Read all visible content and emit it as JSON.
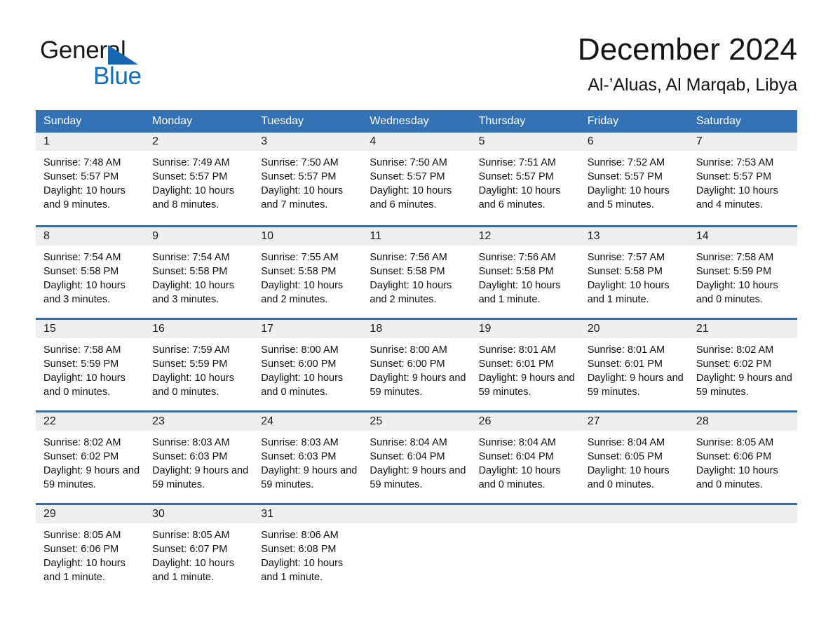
{
  "brand": {
    "name_part1": "General",
    "name_part2": "Blue",
    "triangle_color": "#1567b2",
    "blue_color": "#0d6ebe"
  },
  "header": {
    "title": "December 2024",
    "subtitle": "Al-’Aluas, Al Marqab, Libya"
  },
  "colors": {
    "header_blue": "#3272b5",
    "row_divider_blue": "#2e6da8",
    "day_band_gray": "#efefef"
  },
  "weekdays": [
    "Sunday",
    "Monday",
    "Tuesday",
    "Wednesday",
    "Thursday",
    "Friday",
    "Saturday"
  ],
  "weeks": [
    [
      {
        "day": "1",
        "sunrise": "Sunrise: 7:48 AM",
        "sunset": "Sunset: 5:57 PM",
        "daylight": "Daylight: 10 hours and 9 minutes."
      },
      {
        "day": "2",
        "sunrise": "Sunrise: 7:49 AM",
        "sunset": "Sunset: 5:57 PM",
        "daylight": "Daylight: 10 hours and 8 minutes."
      },
      {
        "day": "3",
        "sunrise": "Sunrise: 7:50 AM",
        "sunset": "Sunset: 5:57 PM",
        "daylight": "Daylight: 10 hours and 7 minutes."
      },
      {
        "day": "4",
        "sunrise": "Sunrise: 7:50 AM",
        "sunset": "Sunset: 5:57 PM",
        "daylight": "Daylight: 10 hours and 6 minutes."
      },
      {
        "day": "5",
        "sunrise": "Sunrise: 7:51 AM",
        "sunset": "Sunset: 5:57 PM",
        "daylight": "Daylight: 10 hours and 6 minutes."
      },
      {
        "day": "6",
        "sunrise": "Sunrise: 7:52 AM",
        "sunset": "Sunset: 5:57 PM",
        "daylight": "Daylight: 10 hours and 5 minutes."
      },
      {
        "day": "7",
        "sunrise": "Sunrise: 7:53 AM",
        "sunset": "Sunset: 5:57 PM",
        "daylight": "Daylight: 10 hours and 4 minutes."
      }
    ],
    [
      {
        "day": "8",
        "sunrise": "Sunrise: 7:54 AM",
        "sunset": "Sunset: 5:58 PM",
        "daylight": "Daylight: 10 hours and 3 minutes."
      },
      {
        "day": "9",
        "sunrise": "Sunrise: 7:54 AM",
        "sunset": "Sunset: 5:58 PM",
        "daylight": "Daylight: 10 hours and 3 minutes."
      },
      {
        "day": "10",
        "sunrise": "Sunrise: 7:55 AM",
        "sunset": "Sunset: 5:58 PM",
        "daylight": "Daylight: 10 hours and 2 minutes."
      },
      {
        "day": "11",
        "sunrise": "Sunrise: 7:56 AM",
        "sunset": "Sunset: 5:58 PM",
        "daylight": "Daylight: 10 hours and 2 minutes."
      },
      {
        "day": "12",
        "sunrise": "Sunrise: 7:56 AM",
        "sunset": "Sunset: 5:58 PM",
        "daylight": "Daylight: 10 hours and 1 minute."
      },
      {
        "day": "13",
        "sunrise": "Sunrise: 7:57 AM",
        "sunset": "Sunset: 5:58 PM",
        "daylight": "Daylight: 10 hours and 1 minute."
      },
      {
        "day": "14",
        "sunrise": "Sunrise: 7:58 AM",
        "sunset": "Sunset: 5:59 PM",
        "daylight": "Daylight: 10 hours and 0 minutes."
      }
    ],
    [
      {
        "day": "15",
        "sunrise": "Sunrise: 7:58 AM",
        "sunset": "Sunset: 5:59 PM",
        "daylight": "Daylight: 10 hours and 0 minutes."
      },
      {
        "day": "16",
        "sunrise": "Sunrise: 7:59 AM",
        "sunset": "Sunset: 5:59 PM",
        "daylight": "Daylight: 10 hours and 0 minutes."
      },
      {
        "day": "17",
        "sunrise": "Sunrise: 8:00 AM",
        "sunset": "Sunset: 6:00 PM",
        "daylight": "Daylight: 10 hours and 0 minutes."
      },
      {
        "day": "18",
        "sunrise": "Sunrise: 8:00 AM",
        "sunset": "Sunset: 6:00 PM",
        "daylight": "Daylight: 9 hours and 59 minutes."
      },
      {
        "day": "19",
        "sunrise": "Sunrise: 8:01 AM",
        "sunset": "Sunset: 6:01 PM",
        "daylight": "Daylight: 9 hours and 59 minutes."
      },
      {
        "day": "20",
        "sunrise": "Sunrise: 8:01 AM",
        "sunset": "Sunset: 6:01 PM",
        "daylight": "Daylight: 9 hours and 59 minutes."
      },
      {
        "day": "21",
        "sunrise": "Sunrise: 8:02 AM",
        "sunset": "Sunset: 6:02 PM",
        "daylight": "Daylight: 9 hours and 59 minutes."
      }
    ],
    [
      {
        "day": "22",
        "sunrise": "Sunrise: 8:02 AM",
        "sunset": "Sunset: 6:02 PM",
        "daylight": "Daylight: 9 hours and 59 minutes."
      },
      {
        "day": "23",
        "sunrise": "Sunrise: 8:03 AM",
        "sunset": "Sunset: 6:03 PM",
        "daylight": "Daylight: 9 hours and 59 minutes."
      },
      {
        "day": "24",
        "sunrise": "Sunrise: 8:03 AM",
        "sunset": "Sunset: 6:03 PM",
        "daylight": "Daylight: 9 hours and 59 minutes."
      },
      {
        "day": "25",
        "sunrise": "Sunrise: 8:04 AM",
        "sunset": "Sunset: 6:04 PM",
        "daylight": "Daylight: 9 hours and 59 minutes."
      },
      {
        "day": "26",
        "sunrise": "Sunrise: 8:04 AM",
        "sunset": "Sunset: 6:04 PM",
        "daylight": "Daylight: 10 hours and 0 minutes."
      },
      {
        "day": "27",
        "sunrise": "Sunrise: 8:04 AM",
        "sunset": "Sunset: 6:05 PM",
        "daylight": "Daylight: 10 hours and 0 minutes."
      },
      {
        "day": "28",
        "sunrise": "Sunrise: 8:05 AM",
        "sunset": "Sunset: 6:06 PM",
        "daylight": "Daylight: 10 hours and 0 minutes."
      }
    ],
    [
      {
        "day": "29",
        "sunrise": "Sunrise: 8:05 AM",
        "sunset": "Sunset: 6:06 PM",
        "daylight": "Daylight: 10 hours and 1 minute."
      },
      {
        "day": "30",
        "sunrise": "Sunrise: 8:05 AM",
        "sunset": "Sunset: 6:07 PM",
        "daylight": "Daylight: 10 hours and 1 minute."
      },
      {
        "day": "31",
        "sunrise": "Sunrise: 8:06 AM",
        "sunset": "Sunset: 6:08 PM",
        "daylight": "Daylight: 10 hours and 1 minute."
      },
      {
        "day": "",
        "sunrise": "",
        "sunset": "",
        "daylight": ""
      },
      {
        "day": "",
        "sunrise": "",
        "sunset": "",
        "daylight": ""
      },
      {
        "day": "",
        "sunrise": "",
        "sunset": "",
        "daylight": ""
      },
      {
        "day": "",
        "sunrise": "",
        "sunset": "",
        "daylight": ""
      }
    ]
  ]
}
